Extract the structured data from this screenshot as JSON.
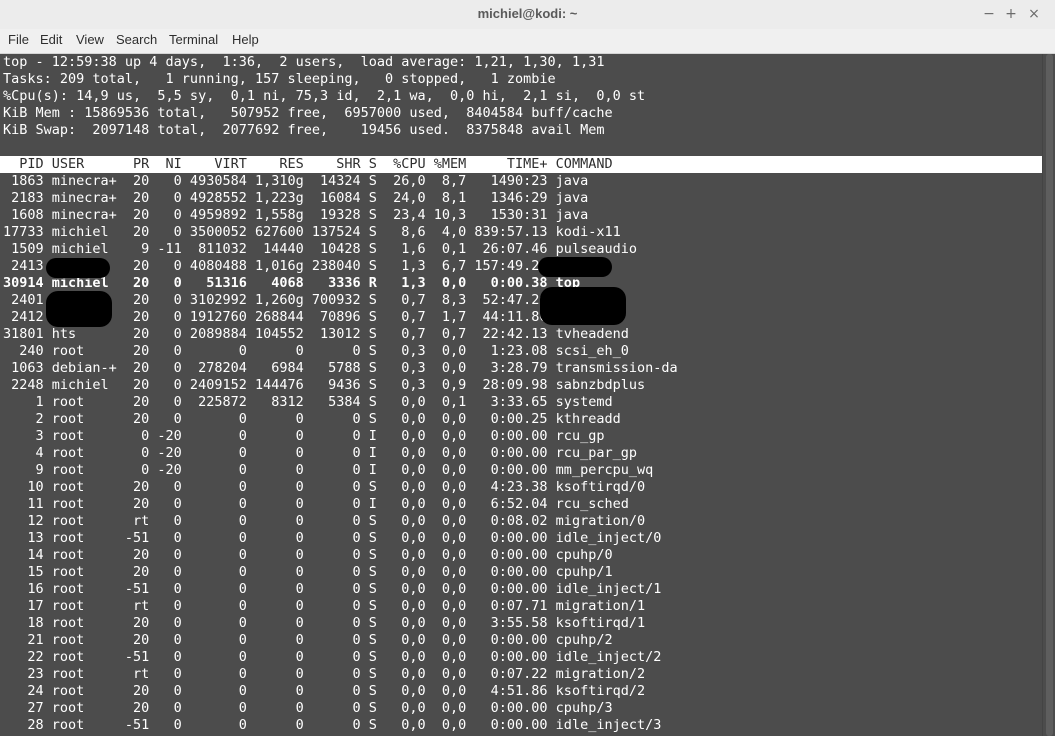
{
  "window": {
    "title": "michiel@kodi: ~",
    "minimize": "−",
    "maximize": "+",
    "close": "×"
  },
  "menu": [
    "File",
    "Edit",
    "View",
    "Search",
    "Terminal",
    "Help"
  ],
  "summary": {
    "uptime": "top - 12:59:38 up 4 days,  1:36,  2 users,  load average: 1,21, 1,30, 1,31",
    "tasks": "Tasks: 209 total,   1 running, 157 sleeping,   0 stopped,   1 zombie",
    "cpu": "%Cpu(s): 14,9 us,  5,5 sy,  0,1 ni, 75,3 id,  2,1 wa,  0,0 hi,  2,1 si,  0,0 st",
    "mem": "KiB Mem : 15869536 total,   507952 free,  6957000 used,  8404584 buff/cache",
    "swap": "KiB Swap:  2097148 total,  2077692 free,    19456 used.  8375848 avail Mem"
  },
  "table": {
    "header": "  PID USER      PR  NI    VIRT    RES    SHR S  %CPU %MEM     TIME+ COMMAND",
    "rows": [
      " 1863 minecra+  20   0 4930584 1,310g  14324 S  26,0  8,7   1490:23 java",
      " 2183 minecra+  20   0 4928552 1,223g  16084 S  24,0  8,1   1346:29 java",
      " 1608 minecra+  20   0 4959892 1,558g  19328 S  23,4 10,3   1530:31 java",
      "17733 michiel   20   0 3500052 627600 137524 S   8,6  4,0 839:57.13 kodi-x11",
      " 1509 michiel    9 -11  811032  14440  10428 S   1,6  0,1  26:07.46 pulseaudio",
      " 2413           20   0 4080488 1,016g 238040 S   1,3  6,7 157:49.25",
      "30914 michiel   20   0   51316   4068   3336 R   1,3  0,0   0:00.38 top",
      " 2401           20   0 3102992 1,260g 700932 S   0,7  8,3  52:47.20",
      " 2412           20   0 1912760 268844  70896 S   0,7  1,7  44:11.86",
      "31801 hts       20   0 2089884 104552  13012 S   0,7  0,7  22:42.13 tvheadend",
      "  240 root      20   0       0      0      0 S   0,3  0,0   1:23.08 scsi_eh_0",
      " 1063 debian-+  20   0  278204   6984   5788 S   0,3  0,0   3:28.79 transmission-da",
      " 2248 michiel   20   0 2409152 144476   9436 S   0,3  0,9  28:09.98 sabnzbdplus",
      "    1 root      20   0  225872   8312   5384 S   0,0  0,1   3:33.65 systemd",
      "    2 root      20   0       0      0      0 S   0,0  0,0   0:00.25 kthreadd",
      "    3 root       0 -20       0      0      0 I   0,0  0,0   0:00.00 rcu_gp",
      "    4 root       0 -20       0      0      0 I   0,0  0,0   0:00.00 rcu_par_gp",
      "    9 root       0 -20       0      0      0 I   0,0  0,0   0:00.00 mm_percpu_wq",
      "   10 root      20   0       0      0      0 S   0,0  0,0   4:23.38 ksoftirqd/0",
      "   11 root      20   0       0      0      0 I   0,0  0,0   6:52.04 rcu_sched",
      "   12 root      rt   0       0      0      0 S   0,0  0,0   0:08.02 migration/0",
      "   13 root     -51   0       0      0      0 S   0,0  0,0   0:00.00 idle_inject/0",
      "   14 root      20   0       0      0      0 S   0,0  0,0   0:00.00 cpuhp/0",
      "   15 root      20   0       0      0      0 S   0,0  0,0   0:00.00 cpuhp/1",
      "   16 root     -51   0       0      0      0 S   0,0  0,0   0:00.00 idle_inject/1",
      "   17 root      rt   0       0      0      0 S   0,0  0,0   0:07.71 migration/1",
      "   18 root      20   0       0      0      0 S   0,0  0,0   3:55.58 ksoftirqd/1",
      "   21 root      20   0       0      0      0 S   0,0  0,0   0:00.00 cpuhp/2",
      "   22 root     -51   0       0      0      0 S   0,0  0,0   0:00.00 idle_inject/2",
      "   23 root      rt   0       0      0      0 S   0,0  0,0   0:07.22 migration/2",
      "   24 root      20   0       0      0      0 S   0,0  0,0   4:51.86 ksoftirqd/2",
      "   27 root      20   0       0      0      0 S   0,0  0,0   0:00.00 cpuhp/3",
      "   28 root     -51   0       0      0      0 S   0,0  0,0   0:00.00 idle_inject/3"
    ]
  },
  "colors": {
    "terminal_bg": "#4c4c4c",
    "terminal_fg": "#ffffff",
    "header_bg": "#ffffff",
    "header_fg": "#2e2e2e",
    "redaction": "#000000"
  }
}
